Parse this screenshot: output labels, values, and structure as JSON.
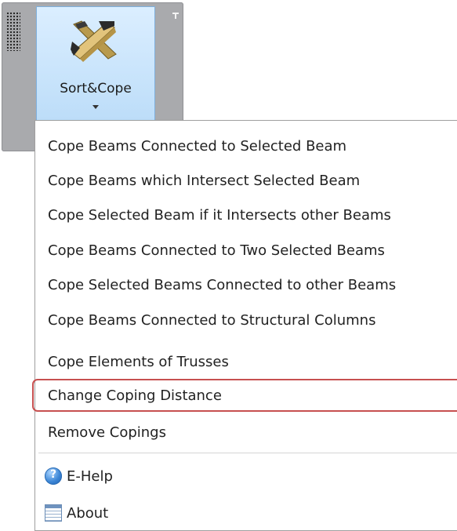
{
  "ribbon": {
    "button_label": "Sort&Cope",
    "icon": "crossed-beams-icon"
  },
  "menu": {
    "items": [
      {
        "label": "Cope Beams Connected to Selected Beam"
      },
      {
        "label": "Cope Beams which Intersect Selected Beam"
      },
      {
        "label": "Cope Selected Beam if it Intersects other Beams"
      },
      {
        "label": "Cope Beams Connected to Two Selected Beams"
      },
      {
        "label": "Cope Selected Beams Connected to other Beams"
      },
      {
        "label": "Cope Beams Connected to Structural Columns"
      },
      {
        "label": "Cope Elements of Trusses"
      },
      {
        "label": "Change Coping Distance",
        "highlighted": true
      },
      {
        "label": "Remove Copings"
      }
    ],
    "extra_items": [
      {
        "label": "E-Help",
        "icon": "help-icon"
      },
      {
        "label": "About",
        "icon": "about-icon"
      }
    ]
  },
  "colors": {
    "highlight_border": "#c75050",
    "button_fill": "#c7e3fb",
    "panel_gray": "#a9aaad"
  }
}
